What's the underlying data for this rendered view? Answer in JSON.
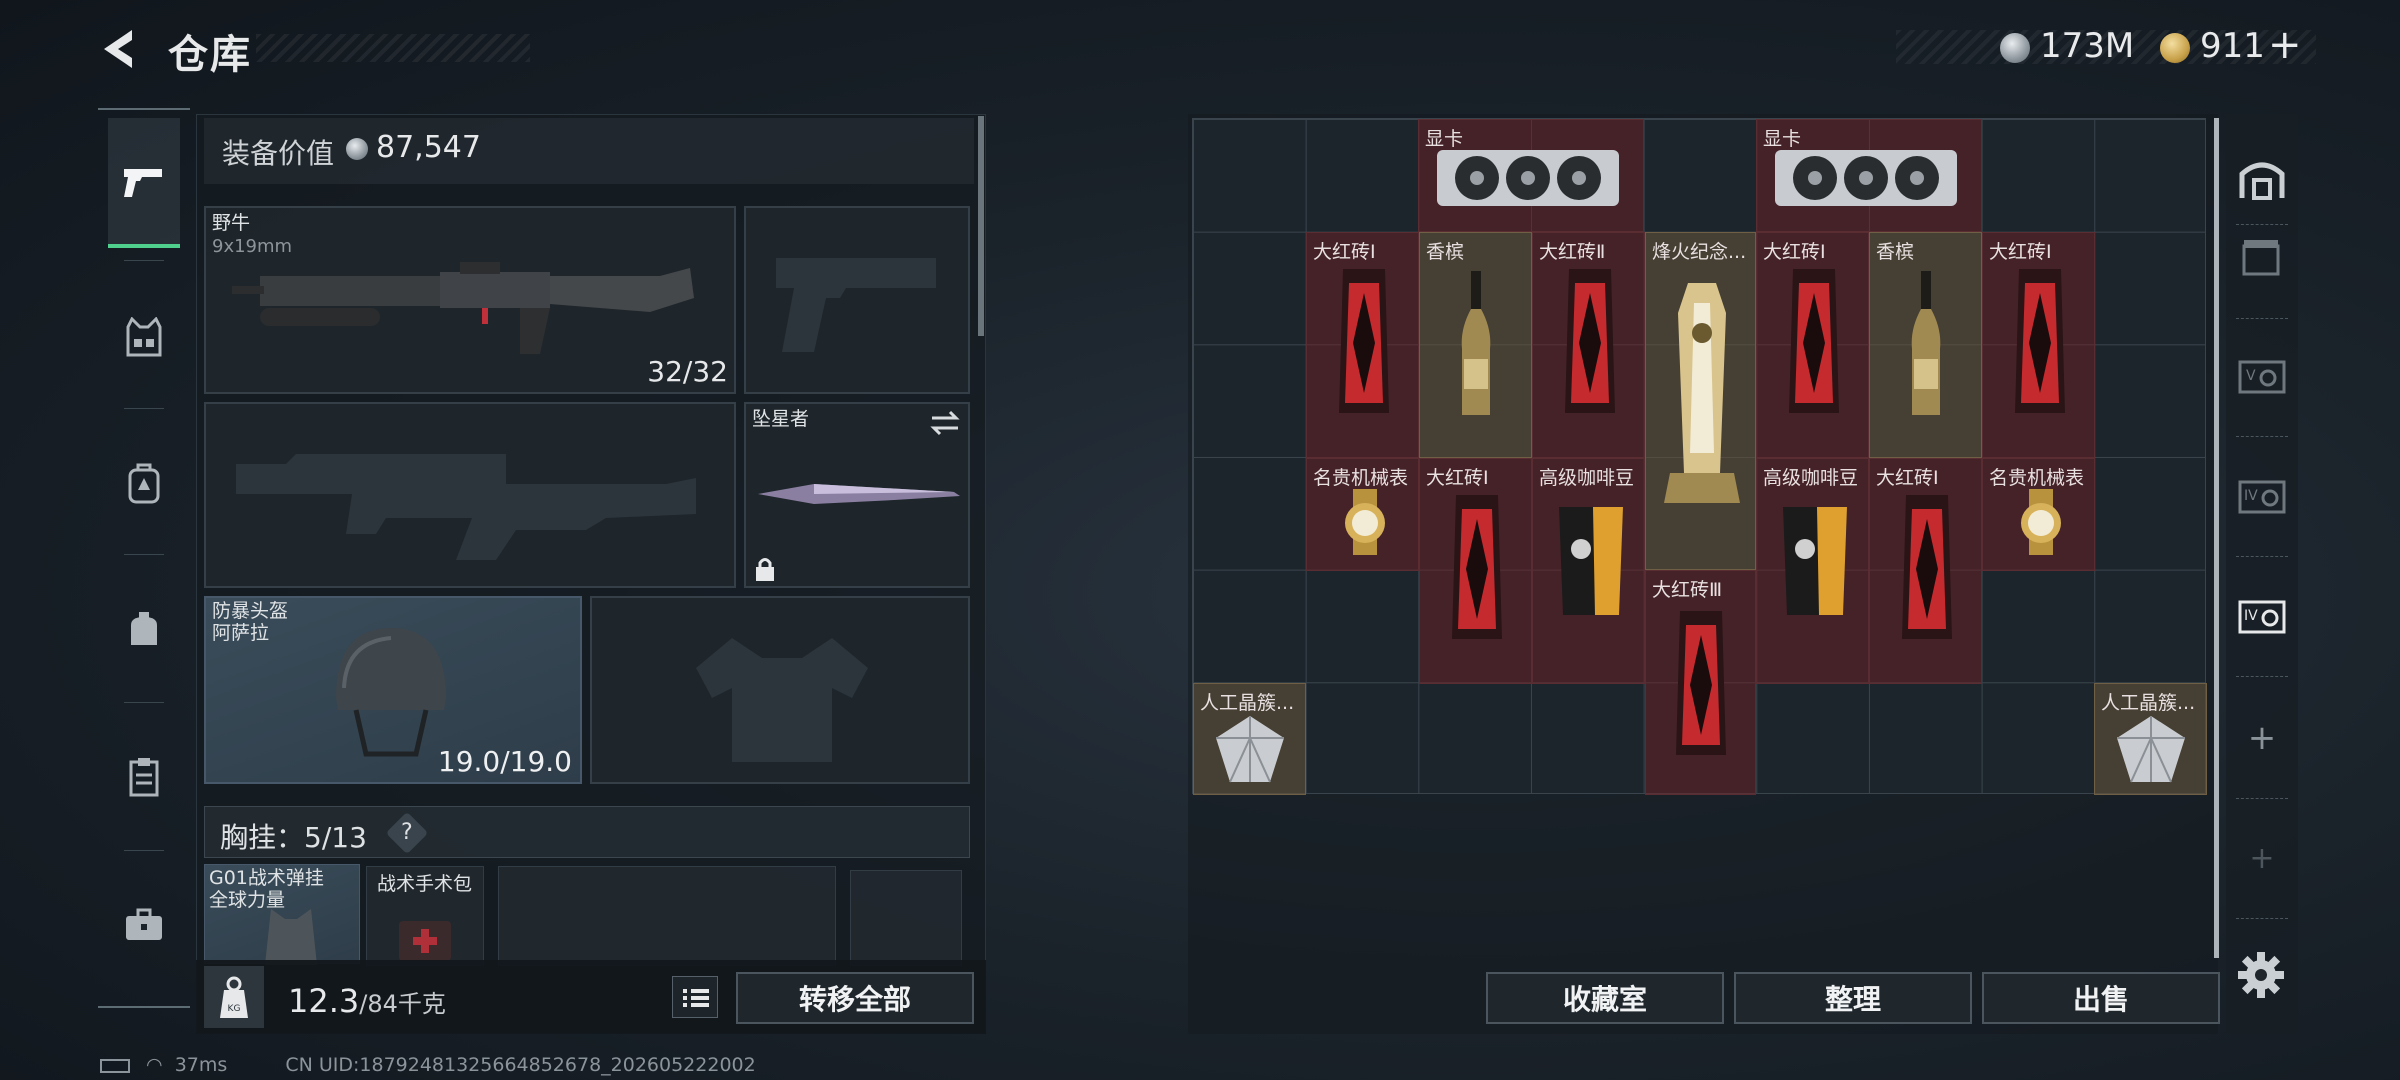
{
  "header": {
    "title": "仓库",
    "currency1": "173M",
    "currency2": "911",
    "currency2_suffix": "+"
  },
  "equipment": {
    "value_label": "装备价值",
    "value": "87,547"
  },
  "slots": {
    "primary": {
      "name": "野牛",
      "ammo": "9x19mm",
      "count": "32/32"
    },
    "melee": {
      "name": "坠星者"
    },
    "helmet": {
      "type": "防暴头盔",
      "name": "阿萨拉",
      "durability": "19.0/19.0"
    }
  },
  "chest": {
    "label": "胸挂：",
    "value": "5/13",
    "help": "?",
    "vest_name": "G01战术弹挂",
    "vest_sub": "全球力量",
    "bag_name": "战术手术包"
  },
  "weight": {
    "value": "12.3",
    "max": "/84千克"
  },
  "buttons": {
    "transfer_all": "转移全部",
    "collection": "收藏室",
    "sort": "整理",
    "sell": "出售"
  },
  "status": {
    "ping": "37ms",
    "uid": "CN UID:18792481325664852678_202605222002"
  },
  "items": [
    {
      "name": "显卡",
      "kind": "gpu"
    },
    {
      "name": "显卡",
      "kind": "gpu"
    },
    {
      "name": "大红砖Ⅰ",
      "kind": "brick"
    },
    {
      "name": "香槟",
      "kind": "champagne"
    },
    {
      "name": "大红砖Ⅱ",
      "kind": "brick"
    },
    {
      "name": "烽火纪念...",
      "kind": "trophy"
    },
    {
      "name": "大红砖Ⅰ",
      "kind": "brick"
    },
    {
      "name": "香槟",
      "kind": "champagne"
    },
    {
      "name": "大红砖Ⅰ",
      "kind": "brick"
    },
    {
      "name": "名贵机械表",
      "kind": "watch"
    },
    {
      "name": "大红砖Ⅰ",
      "kind": "brick"
    },
    {
      "name": "高级咖啡豆",
      "kind": "coffee"
    },
    {
      "name": "高级咖啡豆",
      "kind": "coffee"
    },
    {
      "name": "大红砖Ⅰ",
      "kind": "brick"
    },
    {
      "name": "名贵机械表",
      "kind": "watch"
    },
    {
      "name": "大红砖Ⅲ",
      "kind": "brick"
    },
    {
      "name": "人工晶簇...",
      "kind": "crystal"
    },
    {
      "name": "人工晶簇...",
      "kind": "crystal"
    }
  ],
  "colors": {
    "accent": "#4fd08d",
    "item_red": "#7a1e24",
    "item_gold": "#68563a"
  },
  "icons": [
    "back-icon",
    "coin-silver-icon",
    "coin-gold-icon",
    "pistol-icon",
    "vest-icon",
    "backpack-icon",
    "bag-icon",
    "clipboard-icon",
    "toolbox-icon",
    "weight-icon",
    "list-icon",
    "swap-icon",
    "lock-icon",
    "gear-icon",
    "plus-icon"
  ]
}
